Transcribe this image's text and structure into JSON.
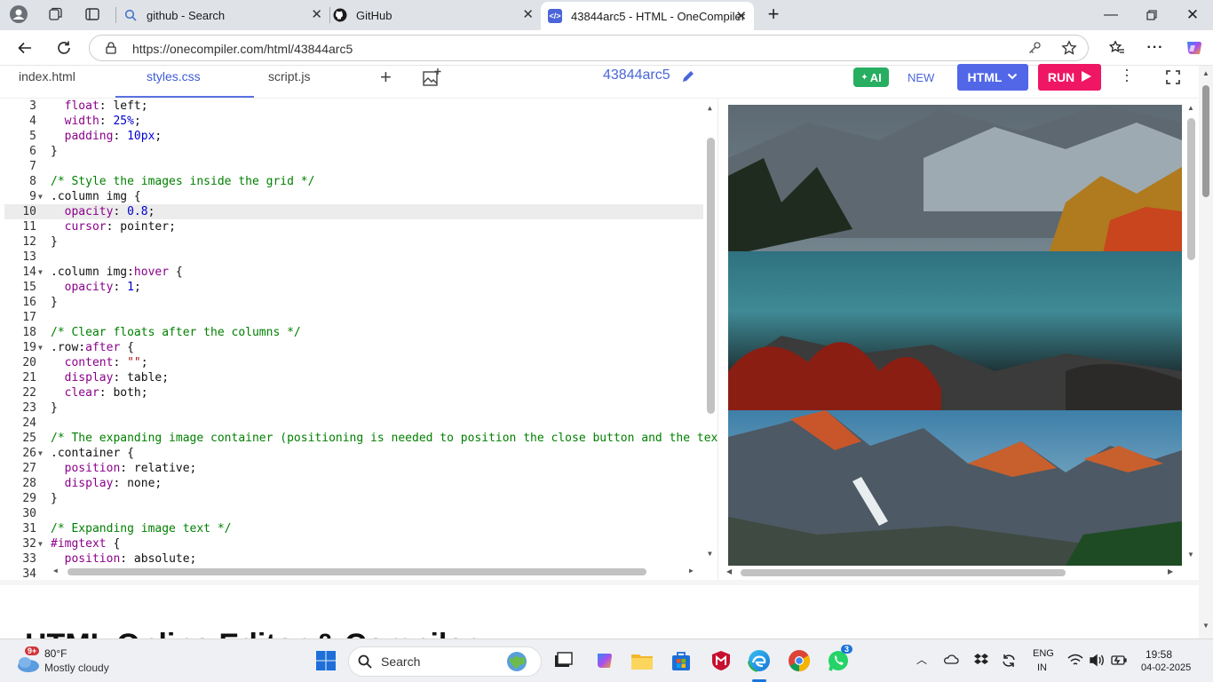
{
  "browser": {
    "tabs": [
      {
        "title": "github - Search",
        "icon": "search-icon",
        "active": false
      },
      {
        "title": "GitHub",
        "icon": "github-icon",
        "active": false
      },
      {
        "title": "43844arc5 - HTML - OneCompiler",
        "icon": "code-icon",
        "active": true
      }
    ],
    "url": "https://onecompiler.com/html/43844arc5"
  },
  "editor": {
    "files": [
      "index.html",
      "styles.css",
      "script.js"
    ],
    "active_file": "styles.css",
    "project_name": "43844arc5",
    "ai_label": "AI",
    "new_label": "NEW",
    "language_label": "HTML",
    "run_label": "RUN",
    "lines": [
      {
        "n": "3",
        "t": "  float: left;"
      },
      {
        "n": "4",
        "t": "  width: 25%;"
      },
      {
        "n": "5",
        "t": "  padding: 10px;"
      },
      {
        "n": "6",
        "t": "}"
      },
      {
        "n": "7",
        "t": ""
      },
      {
        "n": "8",
        "t": "/* Style the images inside the grid */"
      },
      {
        "n": "9",
        "t": ".column img {"
      },
      {
        "n": "10",
        "t": "  opacity: 0.8;"
      },
      {
        "n": "11",
        "t": "  cursor: pointer;"
      },
      {
        "n": "12",
        "t": "}"
      },
      {
        "n": "13",
        "t": ""
      },
      {
        "n": "14",
        "t": ".column img:hover {"
      },
      {
        "n": "15",
        "t": "  opacity: 1;"
      },
      {
        "n": "16",
        "t": "}"
      },
      {
        "n": "17",
        "t": ""
      },
      {
        "n": "18",
        "t": "/* Clear floats after the columns */"
      },
      {
        "n": "19",
        "t": ".row:after {"
      },
      {
        "n": "20",
        "t": "  content: \"\";"
      },
      {
        "n": "21",
        "t": "  display: table;"
      },
      {
        "n": "22",
        "t": "  clear: both;"
      },
      {
        "n": "23",
        "t": "}"
      },
      {
        "n": "24",
        "t": ""
      },
      {
        "n": "25",
        "t": "/* The expanding image container (positioning is needed to position the close button and the tex"
      },
      {
        "n": "26",
        "t": ".container {"
      },
      {
        "n": "27",
        "t": "  position: relative;"
      },
      {
        "n": "28",
        "t": "  display: none;"
      },
      {
        "n": "29",
        "t": "}"
      },
      {
        "n": "30",
        "t": ""
      },
      {
        "n": "31",
        "t": "/* Expanding image text */"
      },
      {
        "n": "32",
        "t": "#imgtext {"
      },
      {
        "n": "33",
        "t": "  position: absolute;"
      },
      {
        "n": "34",
        "t": ""
      }
    ],
    "foldable_lines": [
      "9",
      "14",
      "19",
      "26",
      "32"
    ],
    "highlight_line": "10"
  },
  "page_heading": "HTML Online Editor & Compiler",
  "taskbar": {
    "weather_temp": "80°F",
    "weather_desc": "Mostly cloudy",
    "weather_badge": "9+",
    "search_placeholder": "Search",
    "whatsapp_badge": "3",
    "lang_line1": "ENG",
    "lang_line2": "IN",
    "time": "19:58",
    "date": "04-02-2025"
  },
  "colors": {
    "accent": "#4a66d8",
    "run": "#ef1663",
    "lang_button": "#5167e8",
    "ai_button": "#27ae60"
  }
}
